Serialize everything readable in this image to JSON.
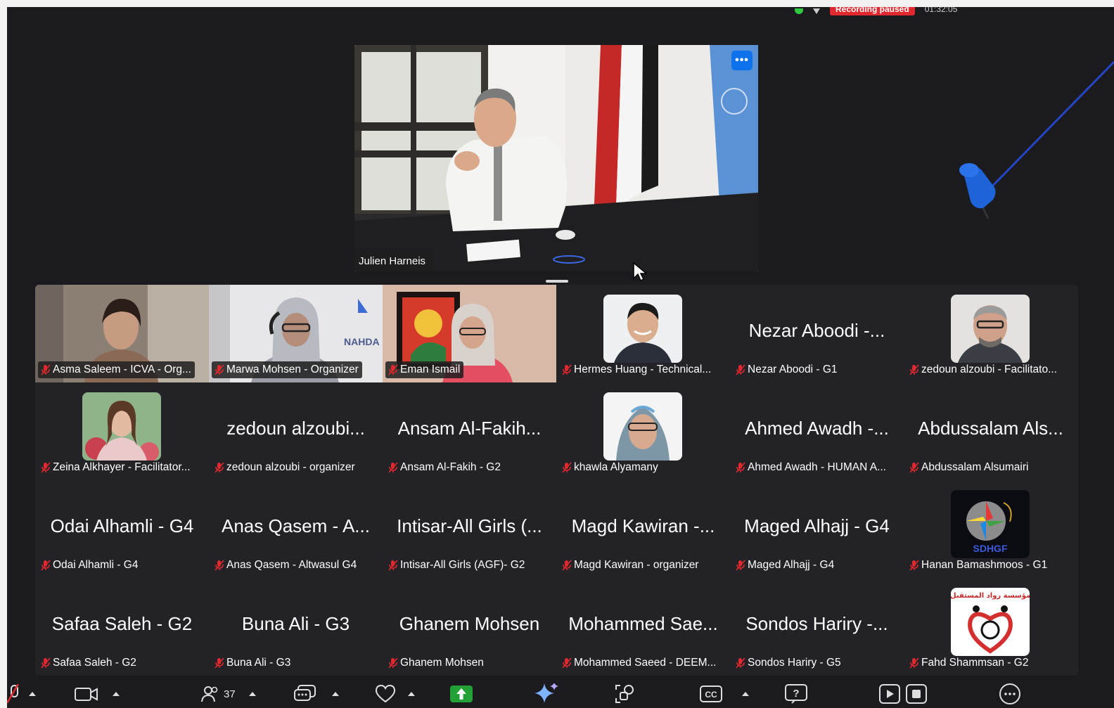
{
  "status": {
    "recording": "Recording paused",
    "timer": "01:32:05"
  },
  "speaker": {
    "name": "Julien Harneis",
    "more_label": "•••"
  },
  "gallery": {
    "tiles": [
      {
        "label": "Asma Saleem - ICVA - Org...",
        "big": ""
      },
      {
        "label": "Marwa Mohsen - Organizer",
        "big": ""
      },
      {
        "label": "Eman Ismail",
        "big": ""
      },
      {
        "label": "Hermes Huang - Technical...",
        "big": ""
      },
      {
        "label": "Nezar Aboodi - G1",
        "big": "Nezar Aboodi -..."
      },
      {
        "label": "zedoun alzoubi - Facilitato...",
        "big": ""
      },
      {
        "label": "Zeina Alkhayer - Facilitator...",
        "big": ""
      },
      {
        "label": "zedoun alzoubi - organizer",
        "big": "zedoun alzoubi..."
      },
      {
        "label": "Ansam Al-Fakih - G2",
        "big": "Ansam Al-Fakih..."
      },
      {
        "label": "khawla Alyamany",
        "big": ""
      },
      {
        "label": "Ahmed Awadh - HUMAN A...",
        "big": "Ahmed Awadh -..."
      },
      {
        "label": "Abdussalam Alsumairi",
        "big": "Abdussalam Als..."
      },
      {
        "label": "Odai Alhamli - G4",
        "big": "Odai Alhamli - G4"
      },
      {
        "label": "Anas Qasem - Altwasul G4",
        "big": "Anas Qasem - A..."
      },
      {
        "label": "Intisar-All Girls (AGF)- G2",
        "big": "Intisar-All Girls (..."
      },
      {
        "label": "Magd Kawiran - organizer",
        "big": "Magd Kawiran -..."
      },
      {
        "label": "Maged Alhajj - G4",
        "big": "Maged Alhajj - G4"
      },
      {
        "label": "Hanan Bamashmoos - G1",
        "big": ""
      },
      {
        "label": "Safaa Saleh - G2",
        "big": "Safaa Saleh - G2"
      },
      {
        "label": "Buna Ali - G3",
        "big": "Buna Ali - G3"
      },
      {
        "label": "Ghanem Mohsen",
        "big": "Ghanem Mohsen"
      },
      {
        "label": "Mohammed Saeed - DEEM...",
        "big": "Mohammed Sae..."
      },
      {
        "label": "Sondos Hariry - G5",
        "big": "Sondos Hariry -..."
      },
      {
        "label": "Fahd Shammsan - G2",
        "big": ""
      }
    ],
    "logo_texts": {
      "sdhgf": "SDHGF",
      "nahda": "NAHDA",
      "rowad": "مؤسسة رواد المستقبل"
    }
  },
  "toolbar": {
    "participants_count": "37"
  },
  "colors": {
    "accent": "#0e72ed",
    "share": "#23a136",
    "recording": "#e0282e",
    "mute": "#e0282e"
  }
}
